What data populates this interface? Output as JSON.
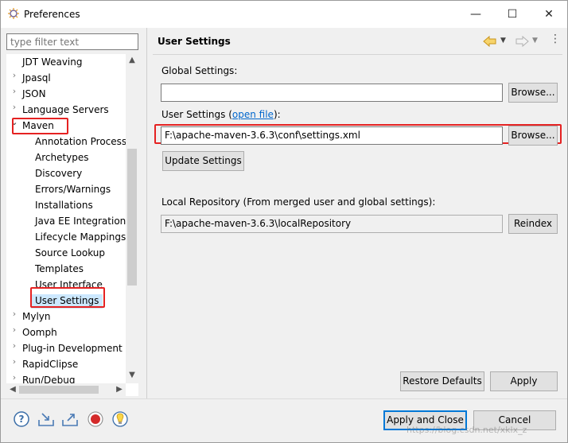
{
  "window": {
    "title": "Preferences",
    "minimize_glyph": "—",
    "maximize_glyph": "☐",
    "close_glyph": "✕"
  },
  "filter": {
    "placeholder": "type filter text"
  },
  "tree": {
    "items": [
      {
        "label": "JDT Weaving",
        "expander": ""
      },
      {
        "label": "Jpasql",
        "expander": "›"
      },
      {
        "label": "JSON",
        "expander": "›"
      },
      {
        "label": "Language Servers",
        "expander": "›"
      },
      {
        "label": "Maven",
        "expander": "⌄"
      },
      {
        "label": "Annotation Process",
        "expander": ""
      },
      {
        "label": "Archetypes",
        "expander": ""
      },
      {
        "label": "Discovery",
        "expander": ""
      },
      {
        "label": "Errors/Warnings",
        "expander": ""
      },
      {
        "label": "Installations",
        "expander": ""
      },
      {
        "label": "Java EE Integration",
        "expander": ""
      },
      {
        "label": "Lifecycle Mappings",
        "expander": ""
      },
      {
        "label": "Source Lookup",
        "expander": ""
      },
      {
        "label": "Templates",
        "expander": ""
      },
      {
        "label": "User Interface",
        "expander": ""
      },
      {
        "label": "User Settings",
        "expander": ""
      },
      {
        "label": "Mylyn",
        "expander": "›"
      },
      {
        "label": "Oomph",
        "expander": "›"
      },
      {
        "label": "Plug-in Development",
        "expander": "›"
      },
      {
        "label": "RapidClipse",
        "expander": "›"
      },
      {
        "label": "Run/Debug",
        "expander": "›"
      }
    ]
  },
  "page": {
    "title": "User Settings",
    "global_label": "Global Settings:",
    "global_value": "",
    "browse1": "Browse...",
    "user_label_prefix": "User Settings (",
    "user_label_link": "open file",
    "user_label_suffix": "):",
    "user_value": "F:\\apache-maven-3.6.3\\conf\\settings.xml",
    "browse2": "Browse...",
    "update": "Update Settings",
    "local_label": "Local Repository (From merged user and global settings):",
    "local_value": "F:\\apache-maven-3.6.3\\localRepository",
    "reindex": "Reindex",
    "restore": "Restore Defaults",
    "apply": "Apply"
  },
  "footer": {
    "apply_close": "Apply and Close",
    "cancel": "Cancel",
    "watermark": "https://blog.csdn.net/xklx_z"
  },
  "colors": {
    "highlight": "#e52222",
    "selection": "#cce8ff",
    "link": "#0066cc"
  }
}
